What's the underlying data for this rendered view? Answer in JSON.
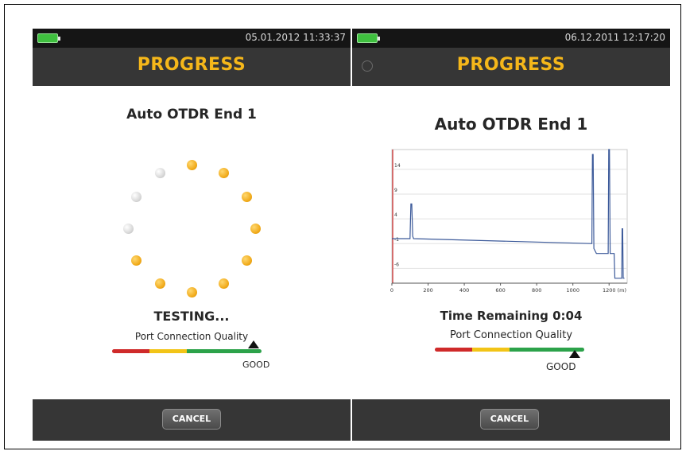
{
  "left_screen": {
    "status": {
      "datetime": "05.01.2012 11:33:37",
      "battery_icon": "battery-icon"
    },
    "title": "PROGRESS",
    "heading": "Auto OTDR End 1",
    "spinner": {
      "active_dots": 9,
      "total_dots": 12
    },
    "status_text": "TESTING...",
    "quality": {
      "label": "Port Connection Quality",
      "value_label": "GOOD",
      "level": 0.95
    },
    "cancel_label": "CANCEL"
  },
  "right_screen": {
    "status": {
      "datetime": "06.12.2011 12:17:20",
      "battery_icon": "battery-icon"
    },
    "title": "PROGRESS",
    "heading": "Auto OTDR End 1",
    "time_remaining": "Time Remaining 0:04",
    "quality": {
      "label": "Port Connection Quality",
      "value_label": "GOOD",
      "level": 0.95
    },
    "cancel_label": "CANCEL"
  },
  "colors": {
    "title": "#f5b71a",
    "bar": "#363636",
    "statusbar": "#151515",
    "quality_red": "#cf2a2a",
    "quality_yellow": "#f2c417",
    "quality_green": "#2ca24a",
    "trace": "#3c5a9a"
  },
  "chart_data": {
    "type": "line",
    "title": "",
    "xlabel": "(m)",
    "ylabel": "",
    "x_ticks": [
      "0",
      "200",
      "400",
      "600",
      "800",
      "1000",
      "1200"
    ],
    "y_ticks": [
      "14",
      "9",
      "4",
      "-1",
      "-6"
    ],
    "xlim": [
      0,
      1300
    ],
    "ylim": [
      -9,
      18
    ],
    "series": [
      {
        "x": [
          0,
          100,
          105,
          110,
          115,
          120,
          1100,
          1105,
          1108,
          1112,
          1116,
          1130,
          1180,
          1195,
          1198,
          1202,
          1206,
          1212,
          1228,
          1232,
          1236,
          1240,
          1270,
          1272,
          1275,
          1278,
          1285
        ],
        "y": [
          0,
          0,
          7,
          7,
          0.5,
          0,
          -1,
          -1,
          17,
          17,
          -2,
          -3,
          -3,
          -3,
          18,
          18,
          -3,
          -3,
          -3,
          -8,
          -8,
          -8,
          -8,
          2,
          2,
          -8,
          -8
        ]
      }
    ],
    "grid": true
  }
}
